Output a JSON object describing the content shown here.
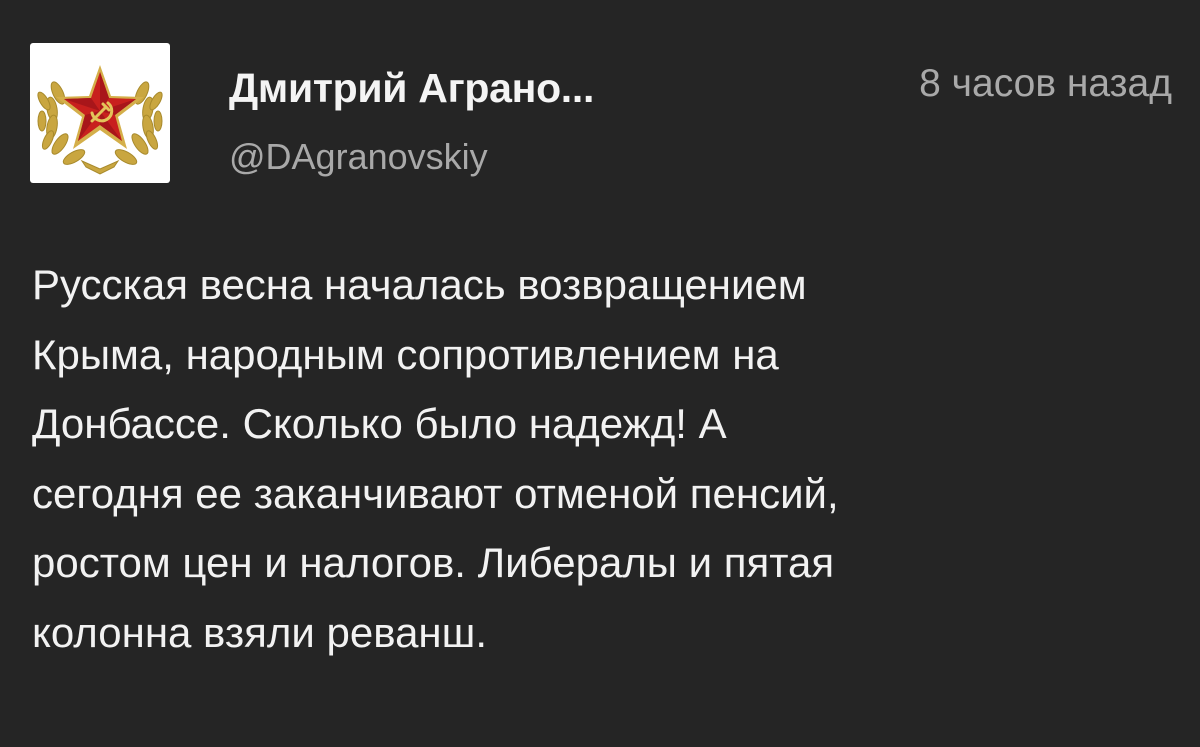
{
  "tweet": {
    "author": {
      "display_name": "Дмитрий Аграно...",
      "handle": "@DAgranovskiy",
      "avatar_icon": "soviet-star-emblem-icon"
    },
    "timestamp": "8 часов назад",
    "text_lines": [
      "Русская весна началась возвращением",
      "Крыма, народным сопротивлением на",
      "Донбассе. Сколько было надежд! А",
      "сегодня ее заканчивают отменой пенсий,",
      "ростом цен и налогов. Либералы и пятая",
      "колонна взяли реванш."
    ]
  },
  "colors": {
    "background": "#252525",
    "primary_text": "#f2f2f2",
    "secondary_text": "#a9a9a9",
    "star_red": "#c8201e",
    "wreath_gold": "#c9a640"
  }
}
